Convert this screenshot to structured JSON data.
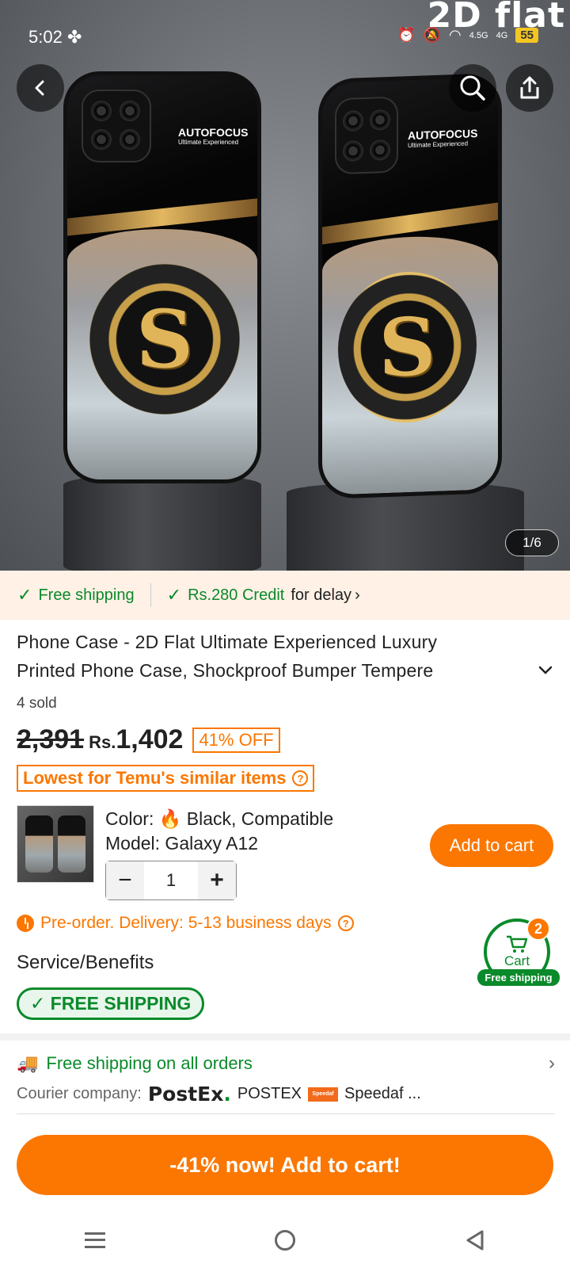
{
  "status_bar": {
    "time": "5:02",
    "network_1": "4.5G",
    "network_2": "4G",
    "battery": "55"
  },
  "hero": {
    "watermark": "2D flat",
    "case_brand": "AUTOFOCUS",
    "case_tagline": "Ultimate Experienced",
    "monogram": "S",
    "image_counter": "1/6"
  },
  "shipping_strip": {
    "free_shipping": "Free shipping",
    "credit": "Rs.280 Credit",
    "credit_suffix": "for delay"
  },
  "product": {
    "title_line1": "Phone Case - 2D Flat Ultimate Experienced Luxury",
    "title_line2": "Printed Phone Case, Shockproof Bumper Tempere",
    "sold": "4 sold",
    "old_price": "2,391",
    "currency": "Rs.",
    "price": "1,402",
    "discount": "41% OFF",
    "lowest_label": "Lowest for Temu's similar items",
    "color_label": "Color:",
    "color_value": "Black, Compatible",
    "color_value_2": "Model: Galaxy A12",
    "quantity": "1",
    "add_to_cart": "Add to cart",
    "preorder": "Pre-order. Delivery: 5-13 business days"
  },
  "service": {
    "heading": "Service/Benefits",
    "badge": "FREE SHIPPING"
  },
  "cart_float": {
    "label": "Cart",
    "count": "2",
    "note": "Free shipping"
  },
  "delivery": {
    "free_all": "Free shipping on all orders",
    "courier_label": "Courier company:",
    "courier1_logo": "PostEx",
    "courier1_name": "POSTEX",
    "courier2_name": "Speedaf ..."
  },
  "cta": {
    "label": "-41% now! Add to cart!"
  },
  "colors": {
    "accent": "#fb7701",
    "green": "#0a8a2a"
  }
}
